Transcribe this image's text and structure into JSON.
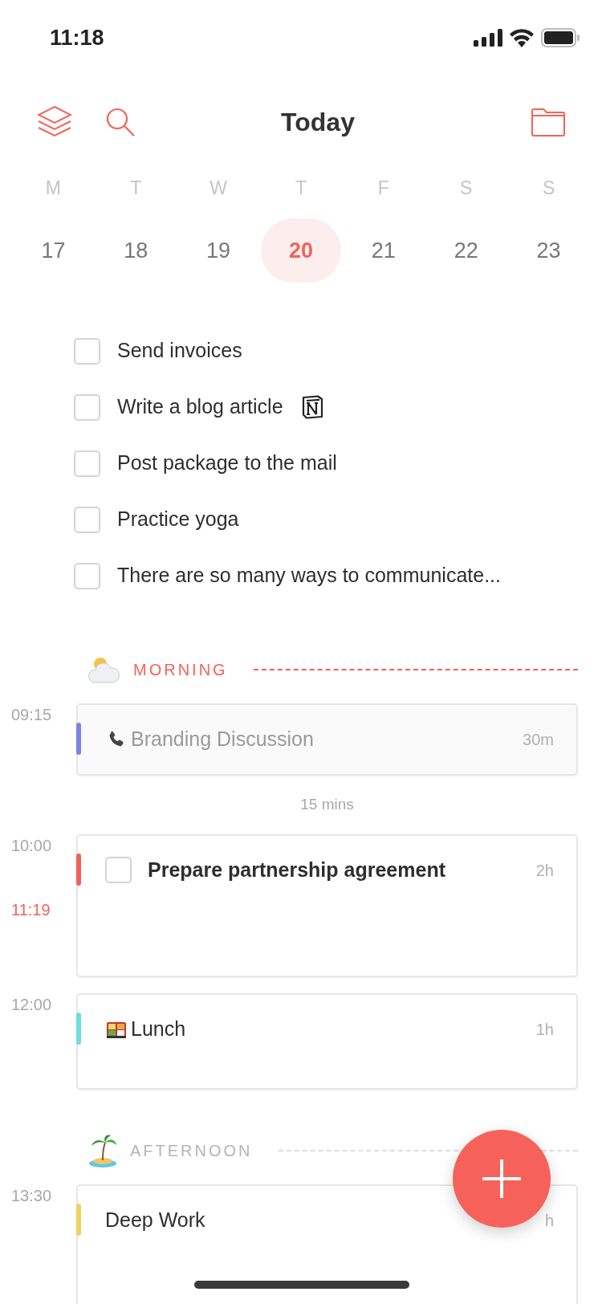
{
  "status_bar": {
    "time": "11:18"
  },
  "header": {
    "title": "Today"
  },
  "week": [
    {
      "weekday": "M",
      "date": "17",
      "selected": false
    },
    {
      "weekday": "T",
      "date": "18",
      "selected": false
    },
    {
      "weekday": "W",
      "date": "19",
      "selected": false
    },
    {
      "weekday": "T",
      "date": "20",
      "selected": true
    },
    {
      "weekday": "F",
      "date": "21",
      "selected": false
    },
    {
      "weekday": "S",
      "date": "22",
      "selected": false
    },
    {
      "weekday": "S",
      "date": "23",
      "selected": false
    }
  ],
  "tasks": [
    {
      "title": "Send invoices",
      "checked": false
    },
    {
      "title": "Write a blog article",
      "checked": false,
      "linked": true
    },
    {
      "title": "Post package to the mail",
      "checked": false
    },
    {
      "title": "Practice yoga",
      "checked": false
    },
    {
      "title": "There are so many ways to communicate...",
      "checked": false
    }
  ],
  "sections": [
    {
      "kind": "morning",
      "label": "MORNING",
      "current": true,
      "items": [
        {
          "kind": "call",
          "time": "09:15",
          "title": "Branding Discussion",
          "duration": "30m",
          "color": "#7b83e8",
          "past": true
        },
        {
          "kind": "gap",
          "label": "15 mins"
        },
        {
          "kind": "task",
          "time": "10:00",
          "now": "11:19",
          "title": "Prepare partnership agreement",
          "duration": "2h",
          "color": "#f0615a",
          "checked": false,
          "past": false
        },
        {
          "kind": "meal",
          "time": "12:00",
          "title": "Lunch",
          "duration": "1h",
          "color": "#6ddfdc",
          "past": false
        }
      ]
    },
    {
      "kind": "afternoon",
      "label": "AFTERNOON",
      "current": false,
      "items": [
        {
          "kind": "plain",
          "time": "13:30",
          "title": "Deep Work",
          "duration": "h",
          "color": "#f0d060",
          "past": false
        }
      ]
    }
  ]
}
